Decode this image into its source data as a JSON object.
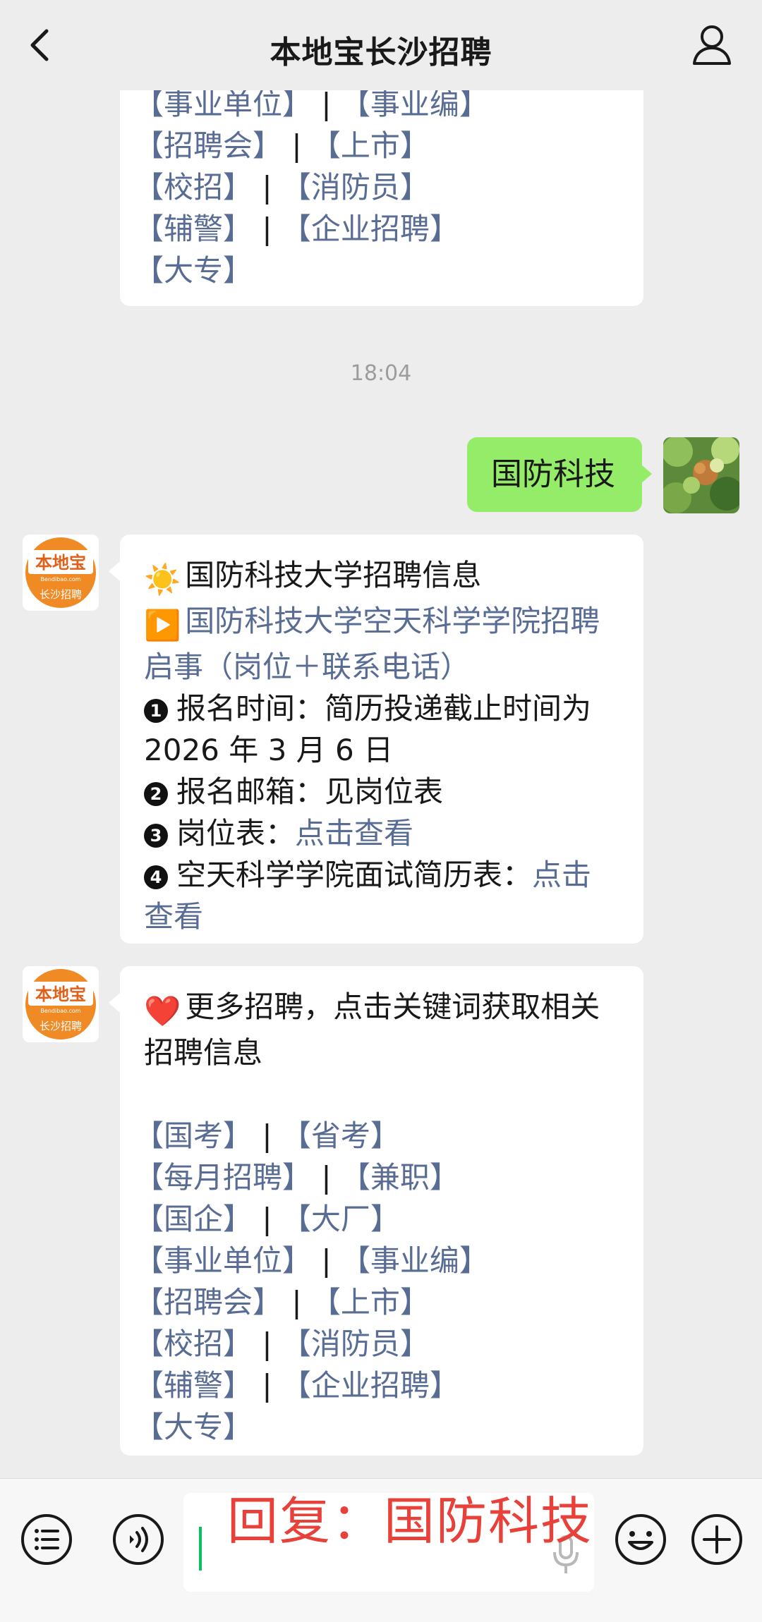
{
  "header": {
    "title": "本地宝长沙招聘",
    "back_icon": "chevron-left-icon",
    "user_icon": "person-icon"
  },
  "top_message": {
    "keyword_lines": [
      [
        "事业单位",
        "事业编"
      ],
      [
        "招聘会",
        "上市"
      ],
      [
        "校招",
        "消防员"
      ],
      [
        "辅警",
        "企业招聘"
      ],
      [
        "大专"
      ]
    ]
  },
  "timestamp": "18:04",
  "user_message": {
    "text": "国防科技"
  },
  "bot_message_1": {
    "sun_emoji": "☀️",
    "title": "国防科技大学招聘信息",
    "play_emoji": "▶️",
    "link_line1": "国防科技大学空天科学学院招聘",
    "link_line2": "启事（岗位＋联系电话）",
    "item1_num": "1",
    "item1_line1": "报名时间：简历投递截止时间为",
    "item1_line2": "2026 年 3 月 6 日",
    "item2_num": "2",
    "item2": "报名邮箱：见岗位表",
    "item3_num": "3",
    "item3_label": "岗位表：",
    "item3_link": "点击查看",
    "item4_num": "4",
    "item4_label": "空天科学学院面试简历表：",
    "item4_link_a": "点击",
    "item4_link_b": "查看"
  },
  "bot_message_2": {
    "heart_emoji": "❤️",
    "intro_line1": "更多招聘，点击关键词获取相关",
    "intro_line2": "招聘信息",
    "keyword_lines": [
      [
        "国考",
        "省考"
      ],
      [
        "每月招聘",
        "兼职"
      ],
      [
        "国企",
        "大厂"
      ],
      [
        "事业单位",
        "事业编"
      ],
      [
        "招聘会",
        "上市"
      ],
      [
        "校招",
        "消防员"
      ],
      [
        "辅警",
        "企业招聘"
      ],
      [
        "大专"
      ]
    ]
  },
  "avatar": {
    "logo_top": "本地宝",
    "logo_url": "Bendibao.com",
    "logo_bottom": "长沙招聘"
  },
  "input_bar": {
    "menu_icon": "menu-list-icon",
    "voice_icon": "voice-icon",
    "emoji_icon": "emoji-icon",
    "plus_icon": "plus-icon",
    "overlay_text": "回复：国防科技"
  },
  "colors": {
    "link": "#586c94",
    "user_bubble": "#95ec69",
    "brand_orange": "#f08a24",
    "overlay": "#e8413a"
  }
}
